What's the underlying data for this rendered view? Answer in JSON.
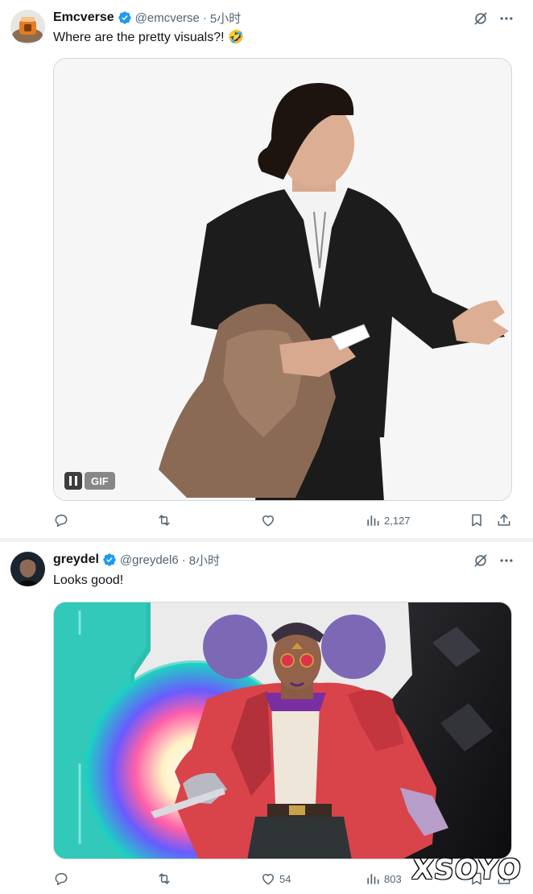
{
  "tweets": [
    {
      "display_name": "Emcverse",
      "handle": "@emcverse",
      "separator": "·",
      "time": "5小时",
      "text": "Where are the pretty visuals?! 🤣",
      "media": {
        "type": "gif",
        "badge": "GIF"
      },
      "stats": {
        "replies": "",
        "retweets": "",
        "likes": "",
        "views": "2,127"
      }
    },
    {
      "display_name": "greydel",
      "handle": "@greydel6",
      "separator": "·",
      "time": "8小时",
      "text": "Looks good!",
      "media": {
        "type": "image"
      },
      "stats": {
        "replies": "",
        "retweets": "",
        "likes": "54",
        "views": "803"
      }
    }
  ],
  "watermark": "XSOYO",
  "colors": {
    "verified": "#1d9bf0",
    "secondary_text": "#536471",
    "border": "#cfd9de"
  },
  "icons": [
    "verified-icon",
    "grok-icon",
    "more-icon",
    "reply-icon",
    "retweet-icon",
    "like-icon",
    "views-icon",
    "bookmark-icon",
    "share-icon",
    "pause-icon"
  ]
}
